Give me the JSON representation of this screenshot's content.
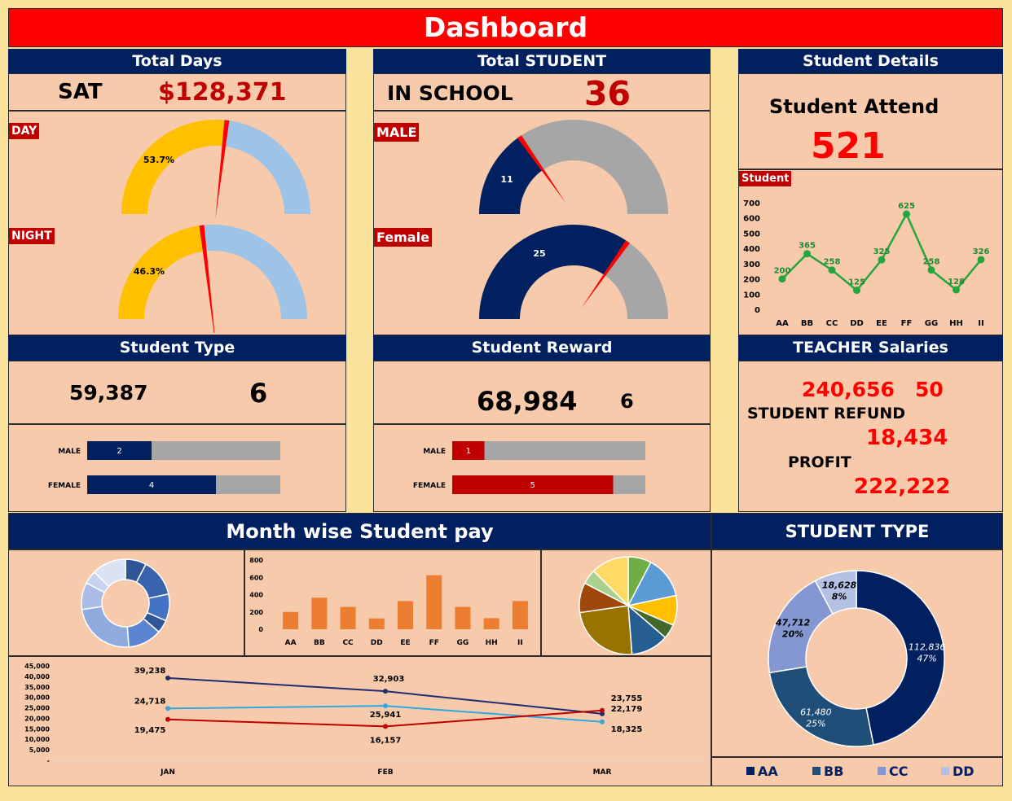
{
  "header": {
    "title": "Dashboard"
  },
  "total_days": {
    "title": "Total Days",
    "label": "SAT",
    "value": "$128,371",
    "day_tag": "DAY",
    "night_tag": "NIGHT",
    "day_pct": 0.537,
    "day_label": "53.7%",
    "night_pct": 0.463,
    "night_label": "46.3%"
  },
  "total_student": {
    "title": "Total STUDENT",
    "label": "IN SCHOOL",
    "value": "36",
    "male_tag": "MALE",
    "female_tag": "Female",
    "male": 11,
    "female": 25,
    "male_label": "11",
    "female_label": "25"
  },
  "student_details": {
    "title": "Student Details",
    "attend_label": "Student Attend",
    "attend_value": "521",
    "chart_tag": "Student"
  },
  "student_type": {
    "title": "Student Type",
    "value": "59,387",
    "count": "6"
  },
  "student_reward": {
    "title": "Student Reward",
    "value": "68,984",
    "count": "6"
  },
  "teacher": {
    "title": "TEACHER Salaries",
    "salary": "240,656",
    "salary_count": "50",
    "refund_label": "STUDENT REFUND",
    "refund": "18,434",
    "profit_label": "PROFIT",
    "profit": "222,222"
  },
  "month_pay": {
    "title": "Month wise Student pay"
  },
  "student_type2": {
    "title": "STUDENT TYPE"
  },
  "colors": {
    "navy": "#002060",
    "red": "#c00000",
    "bright_red": "#ff0000",
    "gold": "#ffc000",
    "light_blue": "#9dc3e6",
    "gray": "#a6a6a6",
    "orange": "#ed7d31",
    "green": "#22a63d",
    "bg": "#f7caac"
  },
  "chart_data": [
    {
      "id": "student_line",
      "type": "line",
      "categories": [
        "AA",
        "BB",
        "CC",
        "DD",
        "EE",
        "FF",
        "GG",
        "HH",
        "II"
      ],
      "values": [
        200,
        365,
        258,
        125,
        325,
        625,
        258,
        128,
        326
      ],
      "labels": [
        "200",
        "365",
        "258",
        "125",
        "325",
        "625",
        "258",
        "128",
        "326"
      ],
      "ylim": [
        0,
        700
      ],
      "yticks": [
        "0",
        "100",
        "200",
        "300",
        "400",
        "500",
        "600",
        "700"
      ]
    },
    {
      "id": "type_bars",
      "type": "bar",
      "orientation": "horizontal",
      "categories": [
        "MALE",
        "FEMALE"
      ],
      "values": [
        2,
        4
      ],
      "labels": [
        "2",
        "4"
      ],
      "max": 6
    },
    {
      "id": "reward_bars",
      "type": "bar",
      "orientation": "horizontal",
      "categories": [
        "MALE",
        "FEMALE"
      ],
      "values": [
        1,
        5
      ],
      "labels": [
        "1",
        "5"
      ],
      "max": 6
    },
    {
      "id": "pay_bars",
      "type": "bar",
      "categories": [
        "AA",
        "BB",
        "CC",
        "DD",
        "EE",
        "FF",
        "GG",
        "HH",
        "II"
      ],
      "values": [
        200,
        365,
        258,
        125,
        325,
        625,
        258,
        128,
        326
      ],
      "ylim": [
        0,
        800
      ],
      "yticks": [
        "0",
        "200",
        "400",
        "600",
        "800"
      ]
    },
    {
      "id": "donut_small",
      "type": "pie",
      "values": [
        200,
        365,
        258,
        125,
        325,
        625,
        258,
        128,
        326
      ]
    },
    {
      "id": "pie_small",
      "type": "pie",
      "values": [
        200,
        365,
        258,
        125,
        325,
        625,
        258,
        128,
        326
      ]
    },
    {
      "id": "month_lines",
      "type": "line",
      "categories": [
        "JAN",
        "FEB",
        "MAR"
      ],
      "ylim": [
        0,
        45000
      ],
      "yticks": [
        "-",
        "5,000",
        "10,000",
        "15,000",
        "20,000",
        "25,000",
        "30,000",
        "35,000",
        "40,000",
        "45,000"
      ],
      "series": [
        {
          "values": [
            39238,
            32903,
            22179
          ],
          "labels": [
            "39,238",
            "32,903",
            "22,179"
          ],
          "color": "#1f2d6e"
        },
        {
          "values": [
            24718,
            25941,
            18325
          ],
          "labels": [
            "24,718",
            "25,941",
            "18,325"
          ],
          "color": "#2fa8e0"
        },
        {
          "values": [
            19475,
            16157,
            23755
          ],
          "labels": [
            "19,475",
            "16,157",
            "23,755"
          ],
          "color": "#c00000"
        }
      ]
    },
    {
      "id": "type_donut",
      "type": "pie",
      "categories": [
        "AA",
        "BB",
        "CC",
        "DD"
      ],
      "values": [
        112836,
        61480,
        47712,
        18628
      ],
      "labels": [
        "112,836",
        "61,480",
        "47,712",
        "18,628"
      ],
      "pcts": [
        "47%",
        "25%",
        "20%",
        "8%"
      ],
      "colors": [
        "#002060",
        "#1f4e79",
        "#8497d3",
        "#b4c0e4"
      ]
    }
  ]
}
